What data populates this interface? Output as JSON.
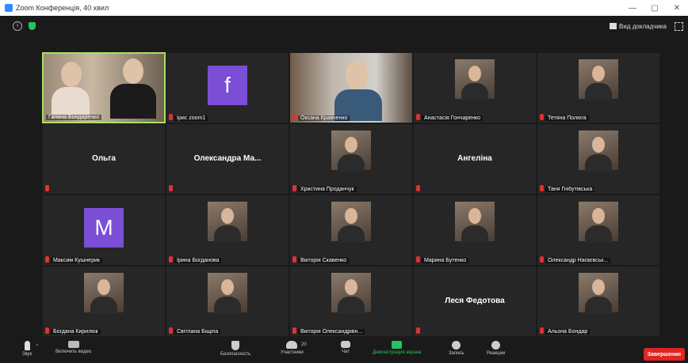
{
  "window": {
    "title": "Zoom Конференція, 40 хвил",
    "minimize": "—",
    "maximize": "▢",
    "close": "✕"
  },
  "topbar": {
    "view_label": "Вид докладчика"
  },
  "tiles": [
    {
      "name": "Галина Бондаренко",
      "kind": "video",
      "video": "v1",
      "active": true,
      "muted": false
    },
    {
      "name": "Ірис zoom1",
      "kind": "avatar",
      "letter": "f",
      "muted": true
    },
    {
      "name": "Оксана Кравченко",
      "kind": "video",
      "video": "v2",
      "muted": true
    },
    {
      "name": "Анастасія Гончаренко",
      "kind": "photo",
      "muted": true
    },
    {
      "name": "Тетяна Полюга",
      "kind": "photo",
      "muted": true
    },
    {
      "name": "Ольга",
      "kind": "text",
      "muted": true
    },
    {
      "name": "Олександра Ма...",
      "kind": "text",
      "muted": true
    },
    {
      "name": "Христина Проданчук",
      "kind": "photo",
      "muted": true
    },
    {
      "name": "Ангеліна",
      "kind": "text",
      "muted": true
    },
    {
      "name": "Таня Гнібутівська",
      "kind": "photo",
      "muted": true
    },
    {
      "name": "Максим Кушнерик",
      "kind": "avatar",
      "letter": "M",
      "muted": true
    },
    {
      "name": "Ірина Богданова",
      "kind": "photo",
      "muted": true
    },
    {
      "name": "Вікторія Скавенко",
      "kind": "photo",
      "muted": true
    },
    {
      "name": "Марина Бутенко",
      "kind": "photo",
      "muted": true
    },
    {
      "name": "Олександр Нагаєвськ...",
      "kind": "photo",
      "muted": true
    },
    {
      "name": "Богдана Кирилюк",
      "kind": "photo",
      "muted": true
    },
    {
      "name": "Світлана Біщіпа",
      "kind": "photo",
      "muted": true
    },
    {
      "name": "Вікторія Олександрівн...",
      "kind": "photo",
      "muted": true
    },
    {
      "name": "Леся Федотова",
      "kind": "text",
      "muted": true
    },
    {
      "name": "Альона Бондар",
      "kind": "photo",
      "muted": true
    }
  ],
  "toolbar": {
    "audio": "Звук",
    "video": "Включить видео",
    "security": "Безопасность",
    "participants": "Участники",
    "participants_count": "20",
    "chat": "Чат",
    "share": "Демонстрация экрана",
    "record": "Запись",
    "reactions": "Реакции",
    "end": "Завершение"
  },
  "colors": {
    "accent_green": "#23c55e",
    "end_red": "#e02424",
    "avatar_purple": "#7b4ed6",
    "active_border": "#a8e05f"
  }
}
